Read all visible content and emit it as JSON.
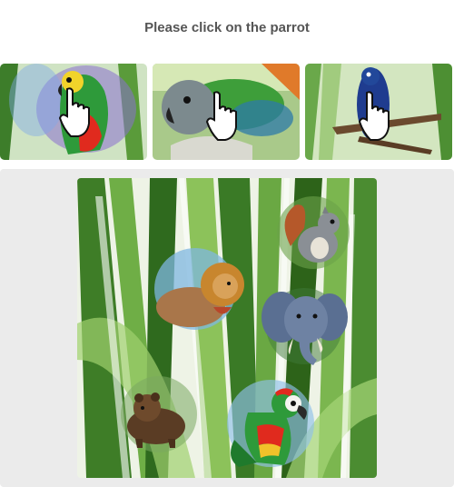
{
  "captcha": {
    "prompt": "Please click on the parrot"
  },
  "examples": [
    {
      "subject": "parrot",
      "icon": "hand-pointer-icon"
    },
    {
      "subject": "parrot",
      "icon": "hand-pointer-icon"
    },
    {
      "subject": "parrot",
      "icon": "hand-pointer-icon"
    }
  ],
  "challenge": {
    "animals": [
      "squirrel",
      "lion",
      "elephant",
      "bear",
      "parrot"
    ]
  },
  "colors": {
    "panel_bg": "#ebebeb",
    "prompt_text": "#555555",
    "leaf_green": "#4f8f2a",
    "parrot_red": "#d92a1f"
  }
}
